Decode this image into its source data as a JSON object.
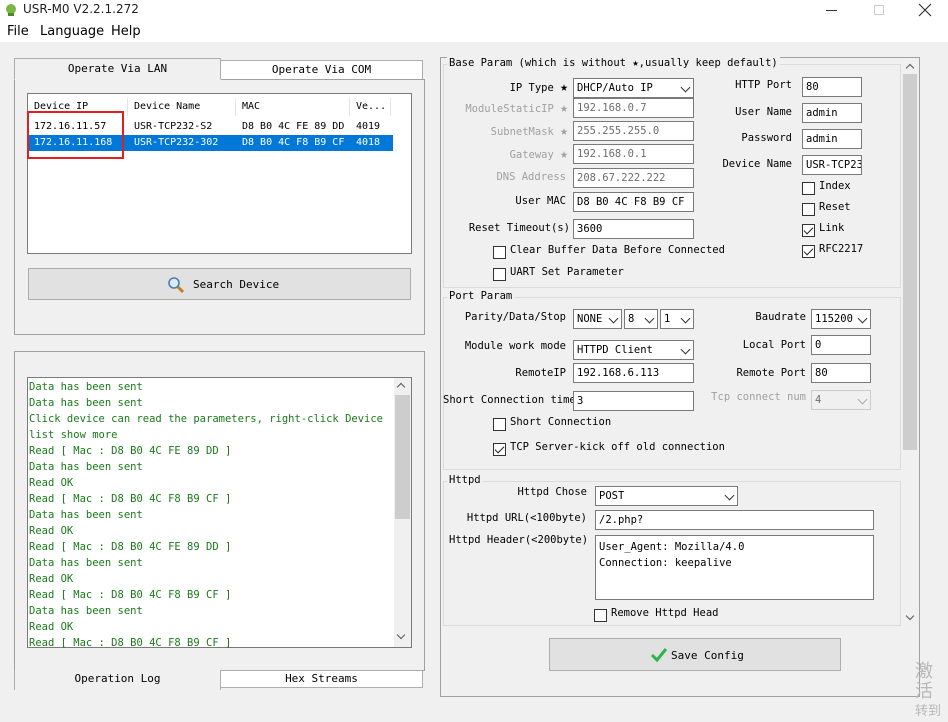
{
  "window": {
    "title": "USR-M0 V2.2.1.272"
  },
  "menu": [
    "File",
    "Language",
    "Help"
  ],
  "left": {
    "tabs": [
      "Operate Via LAN",
      "Operate Via COM"
    ],
    "device_list": {
      "columns": [
        "Device IP",
        "Device Name",
        "MAC",
        "Ve..."
      ],
      "rows": [
        [
          "172.16.11.57",
          "USR-TCP232-S2",
          "D8 B0 4C FE 89 DD",
          "4019"
        ],
        [
          "172.16.11.168",
          "USR-TCP232-302",
          "D8 B0 4C F8 B9 CF",
          "4018"
        ]
      ]
    },
    "search_button": "Search Device",
    "log": [
      " Data has been sent",
      " Data has been sent",
      "Click device can read the parameters, right-click Device",
      "list show more",
      "Read [ Mac : D8 B0 4C FE 89 DD ]",
      " Data has been sent",
      "Read OK",
      "Read [ Mac : D8 B0 4C F8 B9 CF ]",
      " Data has been sent",
      "Read OK",
      "Read [ Mac : D8 B0 4C FE 89 DD ]",
      " Data has been sent",
      "Read OK",
      "Read [ Mac : D8 B0 4C F8 B9 CF ]",
      " Data has been sent",
      "Read OK",
      "Read [ Mac : D8 B0 4C F8 B9 CF ]"
    ],
    "bottom_tabs": [
      "Operation Log",
      "Hex Streams"
    ]
  },
  "base": {
    "title": "Base Param (which is without ★,usually keep default)",
    "ip_type_label": "IP Type",
    "ip_type_value": "DHCP/Auto IP",
    "static_ip_label": "ModuleStaticIP",
    "static_ip_value": "192.168.0.7",
    "subnet_label": "SubnetMask",
    "subnet_value": "255.255.255.0",
    "gateway_label": "Gateway",
    "gateway_value": "192.168.0.1",
    "dns_label": "DNS Address",
    "dns_value": "208.67.222.222",
    "mac_label": "User MAC",
    "mac_value": "D8 B0 4C F8 B9 CF",
    "reset_timeout_label": "Reset Timeout(s)",
    "reset_timeout_value": "3600",
    "clear_buffer_label": "Clear Buffer Data Before Connected",
    "uart_set_label": "UART Set Parameter",
    "http_port_label": "HTTP Port",
    "http_port_value": "80",
    "user_name_label": "User Name",
    "user_name_value": "admin",
    "password_label": "Password",
    "password_value": "admin",
    "device_name_label": "Device Name",
    "device_name_value": "USR-TCP23",
    "index_label": "Index",
    "reset_label": "Reset",
    "link_label": "Link",
    "rfc_label": "RFC2217",
    "star": "★"
  },
  "port": {
    "title": "Port Param",
    "parity_label": "Parity/Data/Stop",
    "parity_value": "NONE",
    "data_value": "8",
    "stop_value": "1",
    "baudrate_label": "Baudrate",
    "baudrate_value": "115200",
    "work_mode_label": "Module work mode",
    "work_mode_value": "HTTPD Client",
    "local_port_label": "Local Port",
    "local_port_value": "0",
    "remote_ip_label": "RemoteIP",
    "remote_ip_value": "192.168.6.113",
    "remote_port_label": "Remote Port",
    "remote_port_value": "80",
    "short_time_label": "Short Connection time",
    "short_time_value": "3",
    "tcp_num_label": "Tcp connect num",
    "tcp_num_value": "4",
    "short_conn_label": "Short Connection",
    "kick_label": "TCP Server-kick off old connection"
  },
  "httpd": {
    "title": "Httpd",
    "chose_label": "Httpd Chose",
    "chose_value": "POST",
    "url_label": "Httpd URL(<100byte)",
    "url_value": "/2.php?",
    "header_label": "Httpd Header(<200byte)",
    "header_line1": "User_Agent: Mozilla/4.0",
    "header_line2": "Connection: keepalive",
    "remove_head_label": "Remove Httpd Head"
  },
  "save_button": "Save Config",
  "watermark": [
    "激活",
    "转到"
  ],
  "colors": {
    "selection": "#0078d7",
    "log_text": "#1a7a1a",
    "highlight_box": "#e02020",
    "check_green": "#2db54a"
  }
}
